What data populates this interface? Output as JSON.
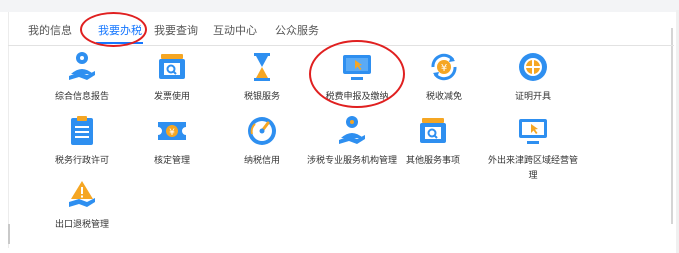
{
  "tabs": [
    {
      "label": "我的信息",
      "active": false
    },
    {
      "label": "我要办税",
      "active": true
    },
    {
      "label": "我要查询",
      "active": false
    },
    {
      "label": "互动中心",
      "active": false
    },
    {
      "label": "公众服务",
      "active": false
    }
  ],
  "items": [
    {
      "label": "综合信息报告",
      "icon": "user-report-icon"
    },
    {
      "label": "发票使用",
      "icon": "invoice-printer-icon"
    },
    {
      "label": "税银服务",
      "icon": "hourglass-icon"
    },
    {
      "label": "税费申报及缴纳",
      "icon": "monitor-cursor-icon"
    },
    {
      "label": "税收减免",
      "icon": "yen-refresh-icon"
    },
    {
      "label": "证明开具",
      "icon": "globe-certificate-icon"
    },
    {
      "label": "税务行政许可",
      "icon": "clipboard-list-icon"
    },
    {
      "label": "核定管理",
      "icon": "yen-ticket-icon"
    },
    {
      "label": "纳税信用",
      "icon": "gauge-icon"
    },
    {
      "label": "涉税专业服务机构管理",
      "icon": "user-agency-icon"
    },
    {
      "label": "其他服务事项",
      "icon": "printer-service-icon"
    },
    {
      "label": "外出来津跨区域经营管理",
      "icon": "monitor-cross-region-icon"
    },
    {
      "label": "出口退税管理",
      "icon": "export-warning-icon"
    }
  ],
  "colors": {
    "accent": "#1677ff",
    "annotation": "#e02020",
    "icon_blue": "#2e8ff0",
    "icon_orange": "#f5a623"
  }
}
